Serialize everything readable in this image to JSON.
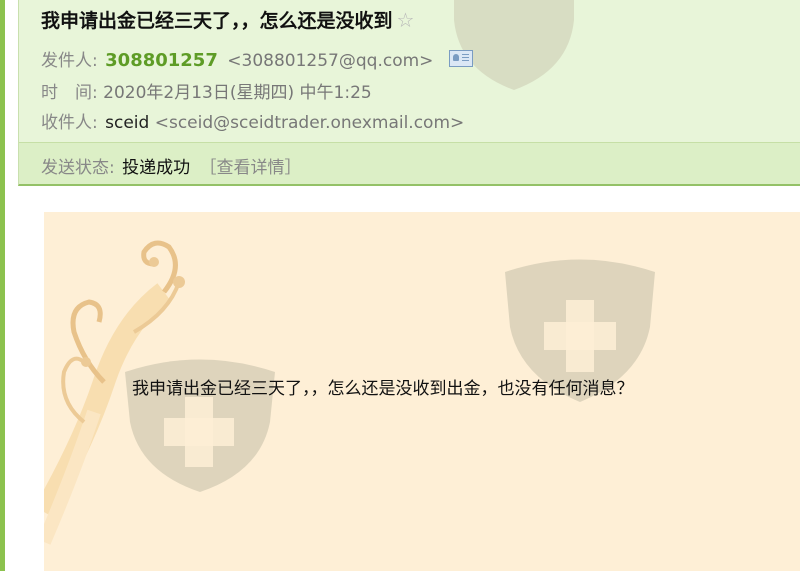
{
  "mail": {
    "subject": "我申请出金已经三天了，，怎么还是没收到",
    "star": "☆",
    "from_label": "发件人:",
    "sender_name": "308801257",
    "sender_address": "<308801257@qq.com>",
    "time_label": "时　间:",
    "time_value": "2020年2月13日(星期四) 中午1:25",
    "to_label": "收件人:",
    "recipient_name": "sceid",
    "recipient_address": "<sceid@sceidtrader.onexmail.com>",
    "status_label": "发送状态:",
    "status_value": "投递成功",
    "status_detail": "［查看详情］",
    "body": "我申请出金已经三天了，，怎么还是没收到出金，也没有任何消息？"
  },
  "icons": [
    "star-icon",
    "contact-card-icon",
    "shield-watermark-icon",
    "vine-decoration"
  ],
  "colors": {
    "header_bg": "#e8f5d9",
    "status_bg": "#dcefc6",
    "sender_green": "#5e9c26",
    "body_bg": "#feefd6",
    "left_rule": "#8cc24e"
  }
}
